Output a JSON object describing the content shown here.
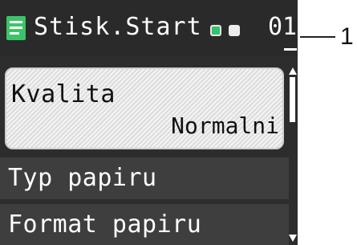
{
  "header": {
    "icon": "document-icon",
    "title": "Stisk.Start",
    "led_colors": [
      "#34c26a",
      "#ececec"
    ],
    "copy_count": "01"
  },
  "menu": {
    "items": [
      {
        "label": "Kvalita",
        "value": "Normalni",
        "selected": true
      },
      {
        "label": "Typ papiru"
      },
      {
        "label": "Format papiru"
      }
    ]
  },
  "scrollbar": {
    "up_icon": "scroll-up-arrow-icon",
    "down_icon": "scroll-down-arrow-icon"
  },
  "callout": {
    "label": "1"
  },
  "colors": {
    "lcd_background": "#2d2d2d",
    "menu_item": "#3e3e3e",
    "selected_item": "#e6e6e6",
    "icon_green": "#3cc36a"
  }
}
